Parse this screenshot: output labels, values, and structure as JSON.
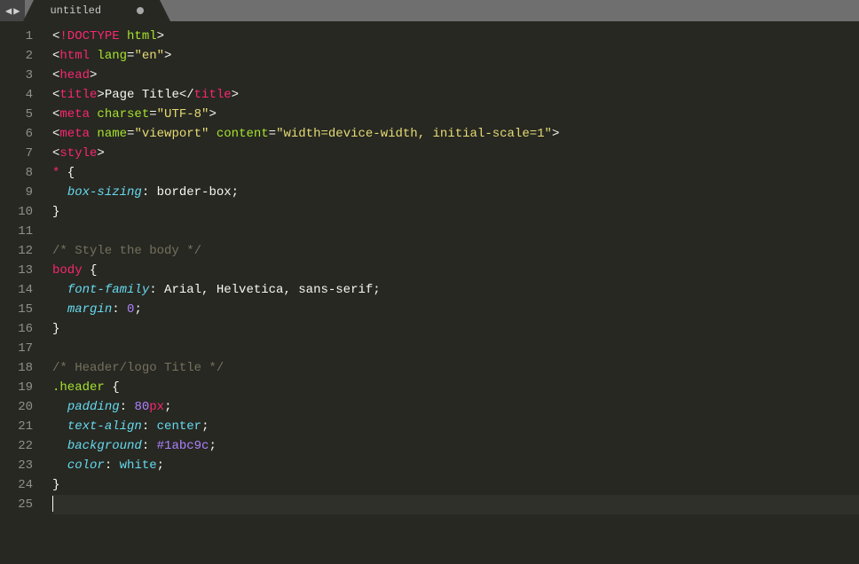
{
  "tabbar": {
    "nav_prev": "◀",
    "nav_next": "▶",
    "tab_name": "untitled",
    "dirty": true
  },
  "colors": {
    "background": "#272822",
    "foreground": "#f8f8f2",
    "keyword": "#f92672",
    "attr": "#a6e22e",
    "string": "#e6db74",
    "number": "#ae81ff",
    "type": "#66d9ef",
    "comment": "#75715e",
    "gutter": "#8f908a",
    "tabbar_bg": "#6f6f6f"
  },
  "line_numbers": [
    "1",
    "2",
    "3",
    "4",
    "5",
    "6",
    "7",
    "8",
    "9",
    "10",
    "11",
    "12",
    "13",
    "14",
    "15",
    "16",
    "17",
    "18",
    "19",
    "20",
    "21",
    "22",
    "23",
    "24",
    "25"
  ],
  "code_tokens": [
    [
      [
        "c-white",
        "<"
      ],
      [
        "c-redtag",
        "!DOCTYPE "
      ],
      [
        "c-green",
        "html"
      ],
      [
        "c-white",
        ">"
      ]
    ],
    [
      [
        "c-white",
        "<"
      ],
      [
        "c-redtag",
        "html "
      ],
      [
        "c-green",
        "lang"
      ],
      [
        "c-white",
        "="
      ],
      [
        "c-yellow",
        "\"en\""
      ],
      [
        "c-white",
        ">"
      ]
    ],
    [
      [
        "c-white",
        "<"
      ],
      [
        "c-redtag",
        "head"
      ],
      [
        "c-white",
        ">"
      ]
    ],
    [
      [
        "c-white",
        "<"
      ],
      [
        "c-redtag",
        "title"
      ],
      [
        "c-white",
        ">"
      ],
      [
        "c-white",
        "Page Title"
      ],
      [
        "c-white",
        "</"
      ],
      [
        "c-redtag",
        "title"
      ],
      [
        "c-white",
        ">"
      ]
    ],
    [
      [
        "c-white",
        "<"
      ],
      [
        "c-redtag",
        "meta "
      ],
      [
        "c-green",
        "charset"
      ],
      [
        "c-white",
        "="
      ],
      [
        "c-yellow",
        "\"UTF-8\""
      ],
      [
        "c-white",
        ">"
      ]
    ],
    [
      [
        "c-white",
        "<"
      ],
      [
        "c-redtag",
        "meta "
      ],
      [
        "c-green",
        "name"
      ],
      [
        "c-white",
        "="
      ],
      [
        "c-yellow",
        "\"viewport\""
      ],
      [
        "c-white",
        " "
      ],
      [
        "c-green",
        "content"
      ],
      [
        "c-white",
        "="
      ],
      [
        "c-yellow",
        "\"width=device-width, initial-scale=1\""
      ],
      [
        "c-white",
        ">"
      ]
    ],
    [
      [
        "c-white",
        "<"
      ],
      [
        "c-redtag",
        "style"
      ],
      [
        "c-white",
        ">"
      ]
    ],
    [
      [
        "c-redtag",
        "*"
      ],
      [
        "c-white",
        " {"
      ]
    ],
    [
      [
        "c-white",
        "  "
      ],
      [
        "c-cyan",
        "box-sizing"
      ],
      [
        "c-white",
        ": border-box;"
      ]
    ],
    [
      [
        "c-white",
        "}"
      ]
    ],
    [],
    [
      [
        "c-gray",
        "/* Style the body */"
      ]
    ],
    [
      [
        "c-redtag",
        "body"
      ],
      [
        "c-white",
        " {"
      ]
    ],
    [
      [
        "c-white",
        "  "
      ],
      [
        "c-cyan",
        "font-family"
      ],
      [
        "c-white",
        ": Arial, Helvetica, sans-serif;"
      ]
    ],
    [
      [
        "c-white",
        "  "
      ],
      [
        "c-cyan",
        "margin"
      ],
      [
        "c-white",
        ": "
      ],
      [
        "c-purple",
        "0"
      ],
      [
        "c-white",
        ";"
      ]
    ],
    [
      [
        "c-white",
        "}"
      ]
    ],
    [],
    [
      [
        "c-gray",
        "/* Header/logo Title */"
      ]
    ],
    [
      [
        "c-green",
        ".header"
      ],
      [
        "c-white",
        " {"
      ]
    ],
    [
      [
        "c-white",
        "  "
      ],
      [
        "c-cyan",
        "padding"
      ],
      [
        "c-white",
        ": "
      ],
      [
        "c-purple",
        "80"
      ],
      [
        "c-redtag",
        "px"
      ],
      [
        "c-white",
        ";"
      ]
    ],
    [
      [
        "c-white",
        "  "
      ],
      [
        "c-cyan",
        "text-align"
      ],
      [
        "c-white",
        ": "
      ],
      [
        "c-cyan-ni",
        "center"
      ],
      [
        "c-white",
        ";"
      ]
    ],
    [
      [
        "c-white",
        "  "
      ],
      [
        "c-cyan",
        "background"
      ],
      [
        "c-white",
        ": "
      ],
      [
        "c-purple",
        "#1abc9c"
      ],
      [
        "c-white",
        ";"
      ]
    ],
    [
      [
        "c-white",
        "  "
      ],
      [
        "c-cyan",
        "color"
      ],
      [
        "c-white",
        ": "
      ],
      [
        "c-cyan-ni",
        "white"
      ],
      [
        "c-white",
        ";"
      ]
    ],
    [
      [
        "c-white",
        "}"
      ]
    ],
    []
  ],
  "cursor_line": 25,
  "cursor_col": 0
}
